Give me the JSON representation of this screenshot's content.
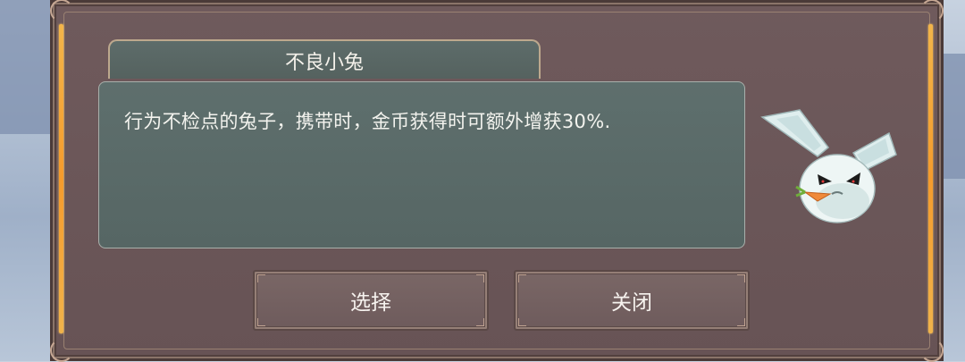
{
  "dialog": {
    "title": "不良小兔",
    "description": "行为不检点的兔子，携带时，金币获得时可额外增获30%.",
    "buttons": {
      "select_label": "选择",
      "close_label": "关闭"
    }
  },
  "pet": {
    "icon": "rabbit-pet-icon"
  },
  "colors": {
    "dialog_bg": "#6f5a5c",
    "panel_bg": "#5e6f6d",
    "gold_accent": "#f59b2c",
    "text": "#f3f3ee"
  }
}
